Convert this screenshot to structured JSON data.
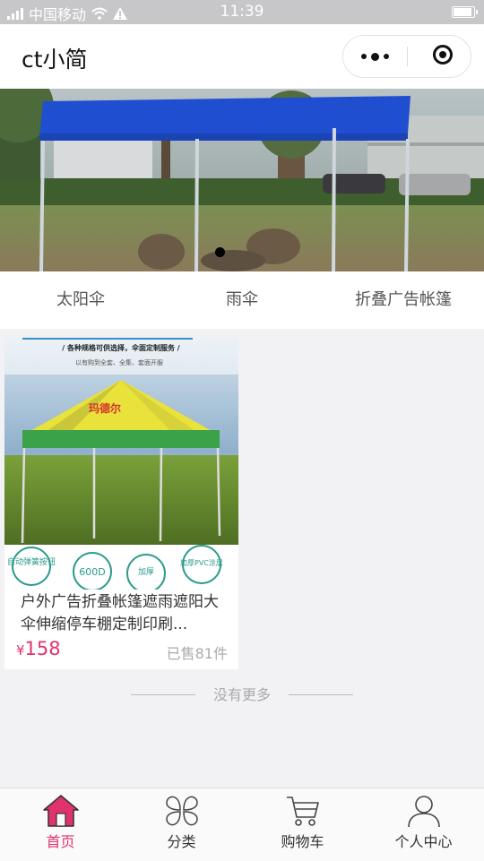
{
  "status_bar": {
    "carrier": "中国移动",
    "time": "11:39"
  },
  "nav": {
    "title": "ct小简"
  },
  "banner": {
    "slide_count": 1,
    "active_index": 0
  },
  "categories": [
    "太阳伞",
    "雨伞",
    "折叠广告帐篷"
  ],
  "products": [
    {
      "name": "户外广告折叠帐篷遮雨遮阳大伞伸缩停车棚定制印刷...",
      "price_symbol": "¥",
      "price": "158",
      "sold": "已售81件",
      "image_texts": {
        "headline": "/ 各种规格可供选择，伞面定制服务 /",
        "subline": "以有购到全套、全集、套面开服",
        "tent_brand": "玛德尔",
        "badges": [
          "自动弹簧按钮",
          "600D",
          "加厚",
          "加厚PVC涂层"
        ]
      }
    }
  ],
  "list_footer": "没有更多",
  "tabbar": [
    {
      "label": "首页",
      "icon": "home-icon",
      "active": true
    },
    {
      "label": "分类",
      "icon": "category-icon",
      "active": false
    },
    {
      "label": "购物车",
      "icon": "cart-icon",
      "active": false
    },
    {
      "label": "个人中心",
      "icon": "user-icon",
      "active": false
    }
  ],
  "colors": {
    "accent": "#e0336e",
    "status_bar": "#c7c7c9",
    "page_bg": "#f2f1f4"
  }
}
